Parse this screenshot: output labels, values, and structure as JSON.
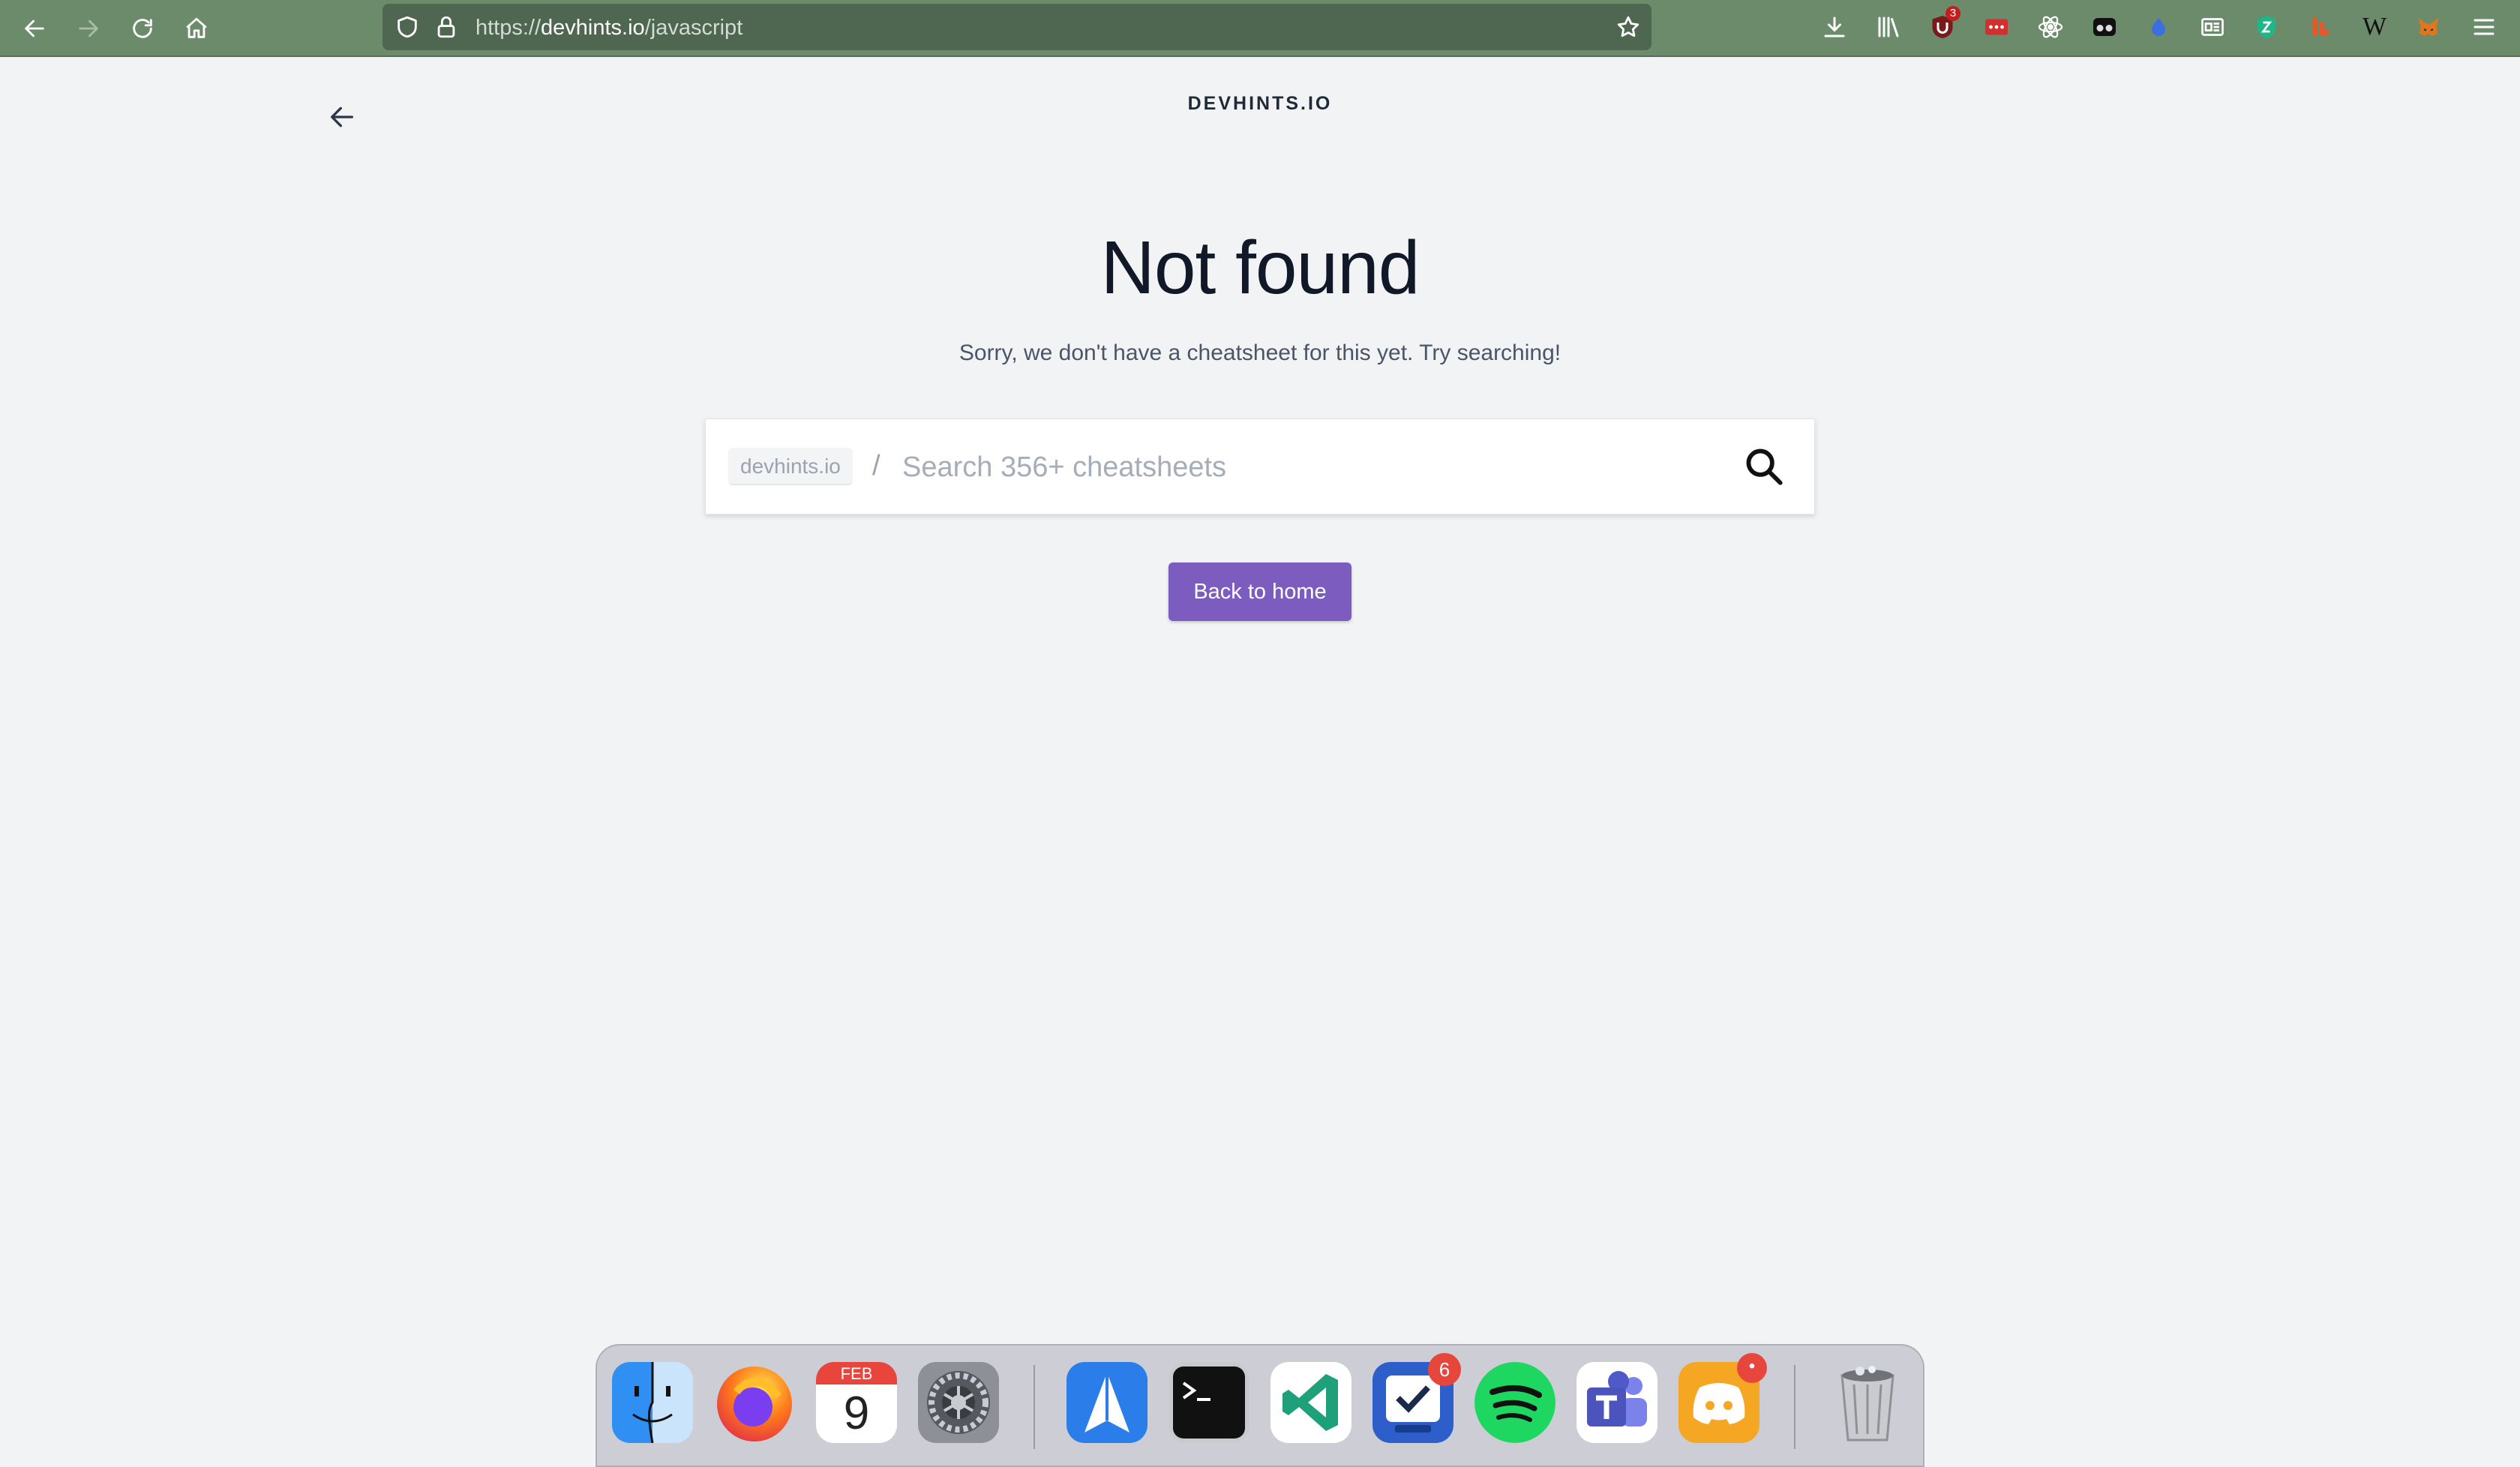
{
  "browser": {
    "url_prefix": "https://",
    "url_domain": "devhints.io",
    "url_path": "/javascript",
    "extensions": [
      {
        "name": "ublock-icon",
        "badge": "3"
      },
      {
        "name": "password-manager-icon"
      },
      {
        "name": "react-devtools-icon"
      },
      {
        "name": "privacy-eyes-icon"
      },
      {
        "name": "blue-drop-icon"
      },
      {
        "name": "reader-card-icon"
      },
      {
        "name": "shield-z-icon"
      },
      {
        "name": "flame-icon"
      },
      {
        "name": "wikipedia-icon",
        "label": "W"
      },
      {
        "name": "metamask-fox-icon"
      }
    ]
  },
  "page": {
    "site_title": "DEVHINTS.IO",
    "heading": "Not found",
    "subheading": "Sorry, we don't have a cheatsheet for this yet. Try searching!",
    "search": {
      "prefix": "devhints.io",
      "separator": "/",
      "placeholder": "Search 356+ cheatsheets",
      "value": ""
    },
    "home_button": "Back to home"
  },
  "dock": {
    "calendar_month": "FEB",
    "calendar_day": "9",
    "things_badge": "6",
    "discord_badge": "•"
  },
  "colors": {
    "toolbar": "#6b8b6b",
    "urlbar": "#4f6650",
    "page_bg": "#f2f3f5",
    "accent_button": "#7c5cbf"
  }
}
